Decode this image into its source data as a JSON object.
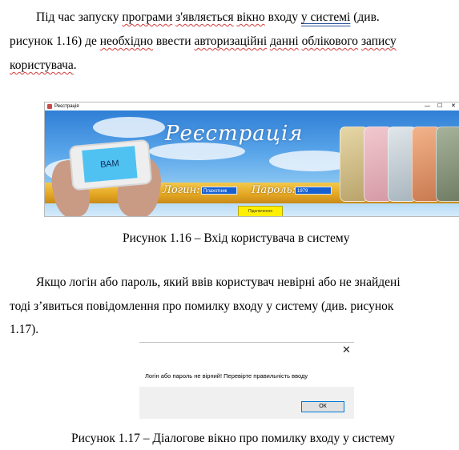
{
  "paragraph1": {
    "line1_indent": "",
    "l1_a": "Під час запуску ",
    "l1_b": "програми",
    "l1_c": " ",
    "l1_d": "з'являється",
    "l1_e": " ",
    "l1_f": "вікно",
    "l1_g": " входу ",
    "l1_h": "у системі",
    "l1_i": " (див.",
    "l2_a": "рисунок 1.16) де ",
    "l2_b": "необхідно",
    "l2_c": " ввести ",
    "l2_d": "авторизаційні",
    "l2_e": " ",
    "l2_f": "данні",
    "l2_g": " ",
    "l2_h": "облікового",
    "l2_i": " ",
    "l2_j": "запису",
    "l3_a": "користувача",
    "l3_b": "."
  },
  "figure1": {
    "window_title": "Реєстрація",
    "window_controls": [
      "—",
      "☐",
      "✕"
    ],
    "heading": "Реєстрація",
    "phone_screen_text": "ВАМ",
    "login_label": "Логин:",
    "login_value": "Плахотник",
    "password_label": "Пароль:",
    "password_value": "1979",
    "connect_button": "Підключення",
    "caption": "Рисунок 1.16 – Вхід користувача в систему"
  },
  "paragraph2": {
    "line1": "Якщо логін або пароль, який ввів користувач невірні або не знайдені",
    "line2": "тоді з’явиться повідомлення про помилку входу у систему (див. рисунок",
    "line3": "1.17)."
  },
  "figure2": {
    "close_glyph": "✕",
    "message": "Логін або пароль не вірний! Перевірте правильність вводу",
    "ok_button": "ОК",
    "caption": "Рисунок 1.17  – Діалогове вікно про помилку входу у систему"
  },
  "colors": {
    "sky": "#5aa6ea",
    "banner": "#e2a421",
    "field": "#1760d0",
    "connect_button": "#ffef00",
    "ok_border": "#0078d7"
  }
}
